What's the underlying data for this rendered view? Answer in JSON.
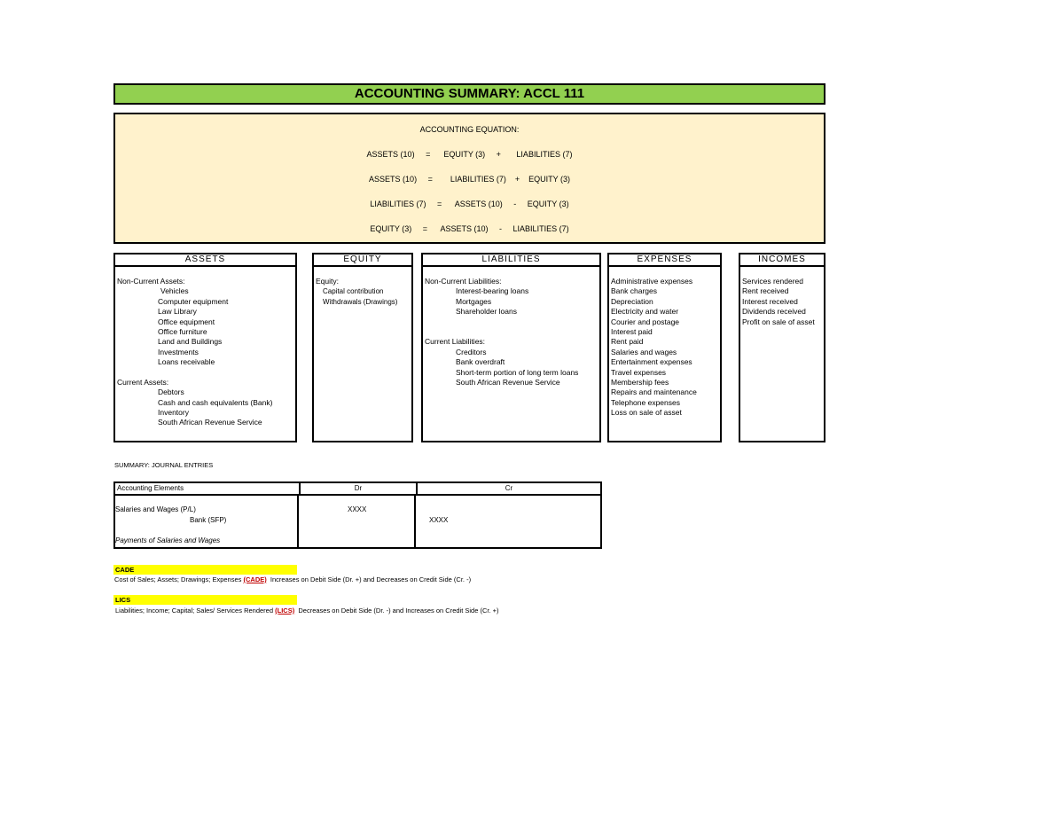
{
  "title": "ACCOUNTING SUMMARY: ACCL 111",
  "equation": {
    "heading": "ACCOUNTING EQUATION:",
    "lines": [
      "ASSETS (10)     =      EQUITY (3)     +       LIABILITIES (7)",
      "ASSETS (10)     =        LIABILITIES (7)    +    EQUITY (3)",
      "LIABILITIES (7)     =      ASSETS (10)     -     EQUITY (3)",
      "EQUITY (3)     =      ASSETS (10)     -     LIABILITIES (7)"
    ]
  },
  "columns": {
    "assets": {
      "header": "ASSETS",
      "noncurrent_label": "Non-Current Assets:",
      "noncurrent_items": [
        "Vehicles",
        "Computer equipment",
        "Law Library",
        "Office equipment",
        "Office furniture",
        "Land and Buildings",
        "Investments",
        "Loans receivable"
      ],
      "current_label": "Current Assets:",
      "current_items": [
        "Debtors",
        "Cash and cash equivalents (Bank)",
        "Inventory",
        "South African Revenue Service"
      ]
    },
    "equity": {
      "header": "EQUITY",
      "label": "Equity:",
      "items": [
        "Capital contribution",
        "Withdrawals (Drawings)"
      ]
    },
    "liabilities": {
      "header": "LIABILITIES",
      "noncurrent_label": "Non-Current Liabilities:",
      "noncurrent_items": [
        "Interest-bearing loans",
        "Mortgages",
        "Shareholder loans"
      ],
      "current_label": "Current Liabilities:",
      "current_items": [
        "Creditors",
        "Bank overdraft",
        "Short-term portion of long term loans",
        "South African Revenue Service"
      ]
    },
    "expenses": {
      "header": "EXPENSES",
      "items": [
        "Administrative expenses",
        "Bank charges",
        "Depreciation",
        "Electricity and water",
        "Courier and postage",
        "Interest paid",
        "Rent paid",
        "Salaries and wages",
        "Entertainment expenses",
        "Travel expenses",
        "Membership fees",
        "Repairs and maintenance",
        "Telephone expenses",
        "Loss on sale of asset"
      ]
    },
    "incomes": {
      "header": "INCOMES",
      "items": [
        "Services rendered",
        "Rent received",
        "Interest received",
        "Dividends received",
        "Profit on sale of asset"
      ]
    }
  },
  "journal": {
    "heading": "SUMMARY: JOURNAL ENTRIES",
    "col_elements": "Accounting Elements",
    "col_dr": "Dr",
    "col_cr": "Cr",
    "entry_debit": "Salaries and Wages (P/L)",
    "entry_credit": "Bank (SFP)",
    "dr_value": "XXXX",
    "cr_value": "XXXX",
    "narration": "Payments of Salaries and Wages"
  },
  "rules": {
    "cade_label": "CADE",
    "cade_text_pre": "Cost of Sales; Assets; Drawings; Expenses",
    "cade_tag": "(CADE)",
    "cade_text_post": "Increases on Debit Side (Dr. +) and Decreases on Credit Side (Cr. -)",
    "lics_label": "LICS",
    "lics_text_pre": "Liabilities; Income; Capital; Sales/ Services Rendered",
    "lics_tag": "(LICS)",
    "lics_text_post": "Decreases on Debit Side (Dr. -) and Increases on Credit Side (Cr. +)"
  }
}
